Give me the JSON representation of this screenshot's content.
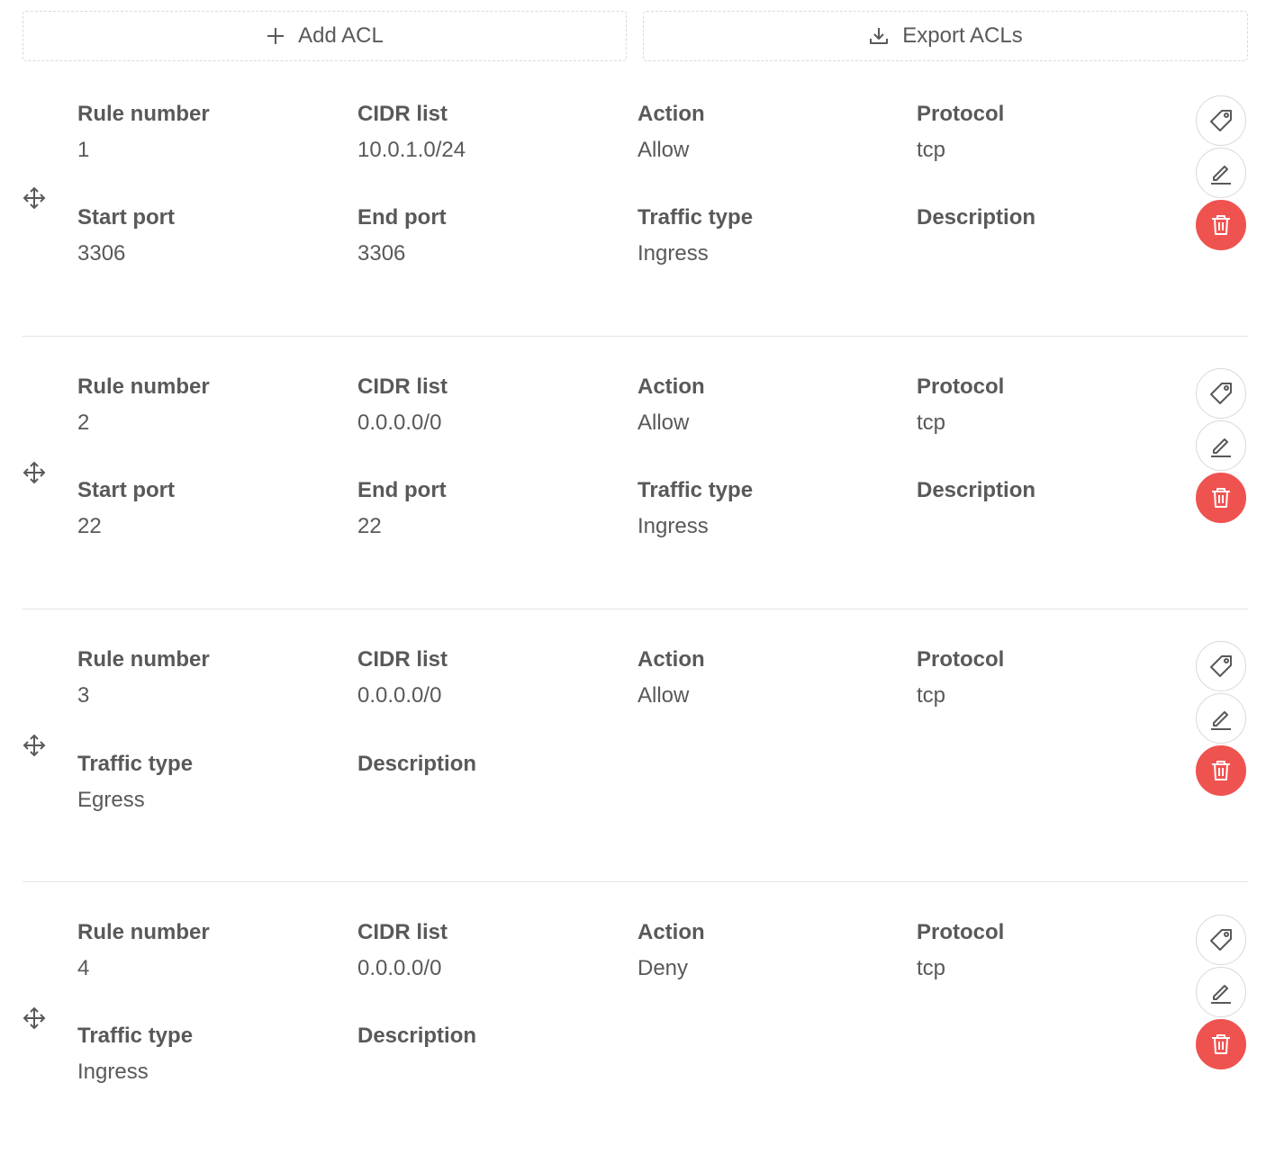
{
  "toolbar": {
    "add_label": "Add ACL",
    "export_label": "Export ACLs"
  },
  "labels": {
    "rule_number": "Rule number",
    "cidr_list": "CIDR list",
    "action": "Action",
    "protocol": "Protocol",
    "start_port": "Start port",
    "end_port": "End port",
    "traffic_type": "Traffic type",
    "description": "Description"
  },
  "rules": [
    {
      "rule_number": "1",
      "cidr_list": "10.0.1.0/24",
      "action": "Allow",
      "protocol": "tcp",
      "start_port": "3306",
      "end_port": "3306",
      "traffic_type": "Ingress",
      "description": ""
    },
    {
      "rule_number": "2",
      "cidr_list": "0.0.0.0/0",
      "action": "Allow",
      "protocol": "tcp",
      "start_port": "22",
      "end_port": "22",
      "traffic_type": "Ingress",
      "description": ""
    },
    {
      "rule_number": "3",
      "cidr_list": "0.0.0.0/0",
      "action": "Allow",
      "protocol": "tcp",
      "traffic_type": "Egress",
      "description": ""
    },
    {
      "rule_number": "4",
      "cidr_list": "0.0.0.0/0",
      "action": "Deny",
      "protocol": "tcp",
      "traffic_type": "Ingress",
      "description": ""
    }
  ],
  "icons": {
    "add": "plus-icon",
    "export": "download-icon",
    "drag": "drag-move-icon",
    "tag": "tag-icon",
    "edit": "edit-icon",
    "delete": "trash-icon"
  },
  "colors": {
    "text": "#595959",
    "danger": "#ef5350",
    "border": "#d9d9d9",
    "divider": "#e5e5e5"
  }
}
